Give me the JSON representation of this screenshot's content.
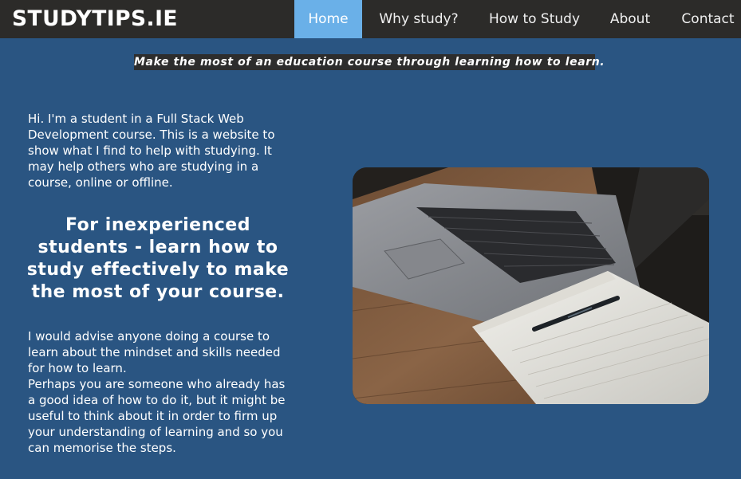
{
  "nav": {
    "brand": "STUDYTIPS.IE",
    "items": [
      {
        "label": "Home",
        "active": true
      },
      {
        "label": "Why study?",
        "active": false
      },
      {
        "label": "How to Study",
        "active": false
      },
      {
        "label": "About",
        "active": false
      },
      {
        "label": "Contact",
        "active": false
      }
    ]
  },
  "tagline": "Make the most of an education course through learning how to learn.",
  "intro": "Hi. I'm a student in a Full Stack Web Development course. This is a website to show what I find to help with studying. It may help others who are studying in a course, online or offline.",
  "headline": "For inexperienced students - learn how to study effectively to make the most of your course.",
  "advice": {
    "line1": "I would advise anyone doing a course to learn about the mindset and skills needed for how to learn.",
    "line2": "Perhaps you are someone who already has a good idea of how to do it, but it might be useful to think about it in order to firm up your understanding of learning and so you can memorise the steps."
  },
  "colors": {
    "page_background": "#2a5582",
    "navbar_background": "#2c2b29",
    "active_nav": "#6ab0e8",
    "tagline_background": "#2d2d2d"
  }
}
